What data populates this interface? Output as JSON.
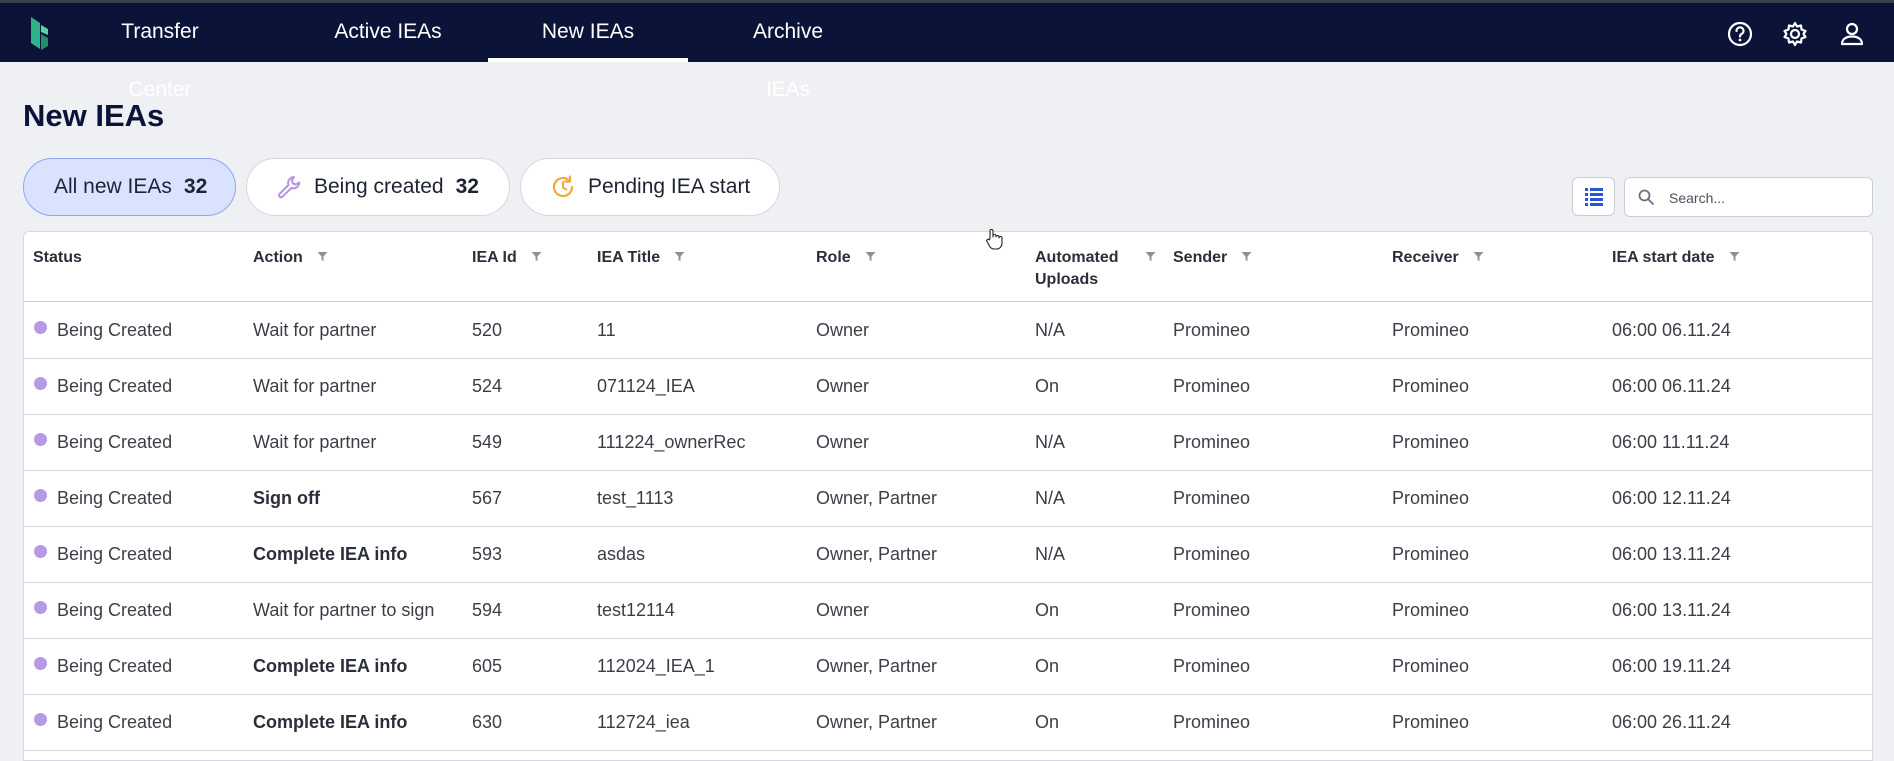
{
  "nav": {
    "items": [
      {
        "label": "Transfer Center",
        "active": false
      },
      {
        "label": "Active IEAs",
        "active": false
      },
      {
        "label": "New IEAs",
        "active": true
      },
      {
        "label": "Archive IEAs",
        "active": false
      }
    ],
    "icons": [
      "help-icon",
      "settings-gear-icon",
      "user-account-icon"
    ]
  },
  "page": {
    "title": "New IEAs"
  },
  "filters": [
    {
      "label": "All new IEAs",
      "count": "32",
      "active": true
    },
    {
      "label": "Being created",
      "count": "32",
      "icon": "wrench-icon"
    },
    {
      "label": "Pending IEA start",
      "icon": "clock-refresh-icon"
    }
  ],
  "search": {
    "placeholder": "Search..."
  },
  "table": {
    "columns": [
      {
        "label": "Status"
      },
      {
        "label": "Action"
      },
      {
        "label": "IEA Id"
      },
      {
        "label": "IEA Title"
      },
      {
        "label": "Role"
      },
      {
        "label": "Automated Uploads"
      },
      {
        "label": "Sender"
      },
      {
        "label": "Receiver"
      },
      {
        "label": "IEA start date"
      }
    ],
    "rows": [
      {
        "status": "Being Created",
        "action": "Wait for partner",
        "action_bold": false,
        "id": "520",
        "title": "11",
        "role": "Owner",
        "uploads": "N/A",
        "sender": "Promineo",
        "receiver": "Promineo",
        "start": "06:00 06.11.24"
      },
      {
        "status": "Being Created",
        "action": "Wait for partner",
        "action_bold": false,
        "id": "524",
        "title": "071124_IEA",
        "role": "Owner",
        "uploads": "On",
        "sender": "Promineo",
        "receiver": "Promineo",
        "start": "06:00 06.11.24"
      },
      {
        "status": "Being Created",
        "action": "Wait for partner",
        "action_bold": false,
        "id": "549",
        "title": "111224_ownerRec",
        "role": "Owner",
        "uploads": "N/A",
        "sender": "Promineo",
        "receiver": "Promineo",
        "start": "06:00 11.11.24"
      },
      {
        "status": "Being Created",
        "action": "Sign off",
        "action_bold": true,
        "id": "567",
        "title": "test_1113",
        "role": "Owner, Partner",
        "uploads": "N/A",
        "sender": "Promineo",
        "receiver": "Promineo",
        "start": "06:00 12.11.24"
      },
      {
        "status": "Being Created",
        "action": "Complete IEA info",
        "action_bold": true,
        "id": "593",
        "title": "asdas",
        "role": "Owner, Partner",
        "uploads": "N/A",
        "sender": "Promineo",
        "receiver": "Promineo",
        "start": "06:00 13.11.24"
      },
      {
        "status": "Being Created",
        "action": "Wait for partner to sign",
        "action_bold": false,
        "id": "594",
        "title": "test12114",
        "role": "Owner",
        "uploads": "On",
        "sender": "Promineo",
        "receiver": "Promineo",
        "start": "06:00 13.11.24"
      },
      {
        "status": "Being Created",
        "action": "Complete IEA info",
        "action_bold": true,
        "id": "605",
        "title": "112024_IEA_1",
        "role": "Owner, Partner",
        "uploads": "On",
        "sender": "Promineo",
        "receiver": "Promineo",
        "start": "06:00 19.11.24"
      },
      {
        "status": "Being Created",
        "action": "Complete IEA info",
        "action_bold": true,
        "id": "630",
        "title": "112724_iea",
        "role": "Owner, Partner",
        "uploads": "On",
        "sender": "Promineo",
        "receiver": "Promineo",
        "start": "06:00 26.11.24"
      }
    ]
  },
  "colors": {
    "nav_bg": "#0b1438",
    "status_dot": "#b59be4",
    "chip_active": "#d9e3ff",
    "brand_green": "#2db38a"
  }
}
